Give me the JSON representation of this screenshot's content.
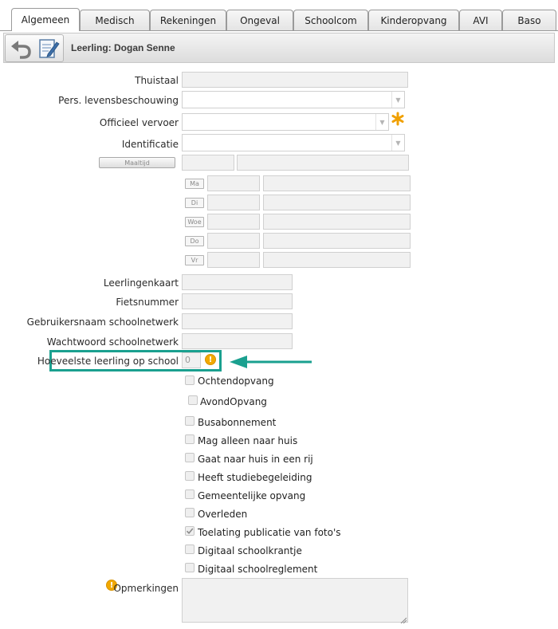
{
  "tabs": [
    {
      "label": "Algemeen",
      "active": true
    },
    {
      "label": "Medisch"
    },
    {
      "label": "Rekeningen"
    },
    {
      "label": "Ongeval"
    },
    {
      "label": "Schoolcom"
    },
    {
      "label": "Kinderopvang"
    },
    {
      "label": "AVI"
    },
    {
      "label": "Baso"
    }
  ],
  "header": {
    "title": "Leerling: Dogan Senne",
    "icons": [
      "undo-icon",
      "notepad-icon"
    ]
  },
  "form": {
    "thuistaal_label": "Thuistaal",
    "thuistaal_value": "",
    "levensbeschouwing_label": "Pers. levensbeschouwing",
    "levensbeschouwing_value": "",
    "vervoer_label": "Officieel vervoer",
    "vervoer_value": "",
    "identificatie_label": "Identificatie",
    "identificatie_value": "",
    "maaltijd_button": "Maaltijd",
    "days": [
      "Ma",
      "Di",
      "Woe",
      "Do",
      "Vr"
    ],
    "leerlingenkaart_label": "Leerlingenkaart",
    "fietsnummer_label": "Fietsnummer",
    "gebruikersnaam_label": "Gebruikersnaam schoolnetwerk",
    "wachtwoord_label": "Wachtwoord schoolnetwerk",
    "hoeveelste_label": "Hoeveelste leerling op school",
    "hoeveelste_value": "0",
    "opmerkingen_label": "Opmerkingen"
  },
  "checkboxes": [
    {
      "label": "Ochtendopvang",
      "checked": false
    },
    {
      "label": "AvondOpvang",
      "checked": false
    },
    {
      "label": "Busabonnement",
      "checked": false
    },
    {
      "label": "Mag alleen naar huis",
      "checked": false
    },
    {
      "label": "Gaat naar huis in een rij",
      "checked": false
    },
    {
      "label": "Heeft studiebegeleiding",
      "checked": false
    },
    {
      "label": "Gemeentelijke opvang",
      "checked": false
    },
    {
      "label": "Overleden",
      "checked": false
    },
    {
      "label": "Toelating publicatie van foto's",
      "checked": true
    },
    {
      "label": "Digitaal schoolkrantje",
      "checked": false
    },
    {
      "label": "Digitaal schoolreglement",
      "checked": false
    }
  ],
  "colors": {
    "highlight": "#1aa08f",
    "info": "#f2a900",
    "required": "#f0a000"
  }
}
